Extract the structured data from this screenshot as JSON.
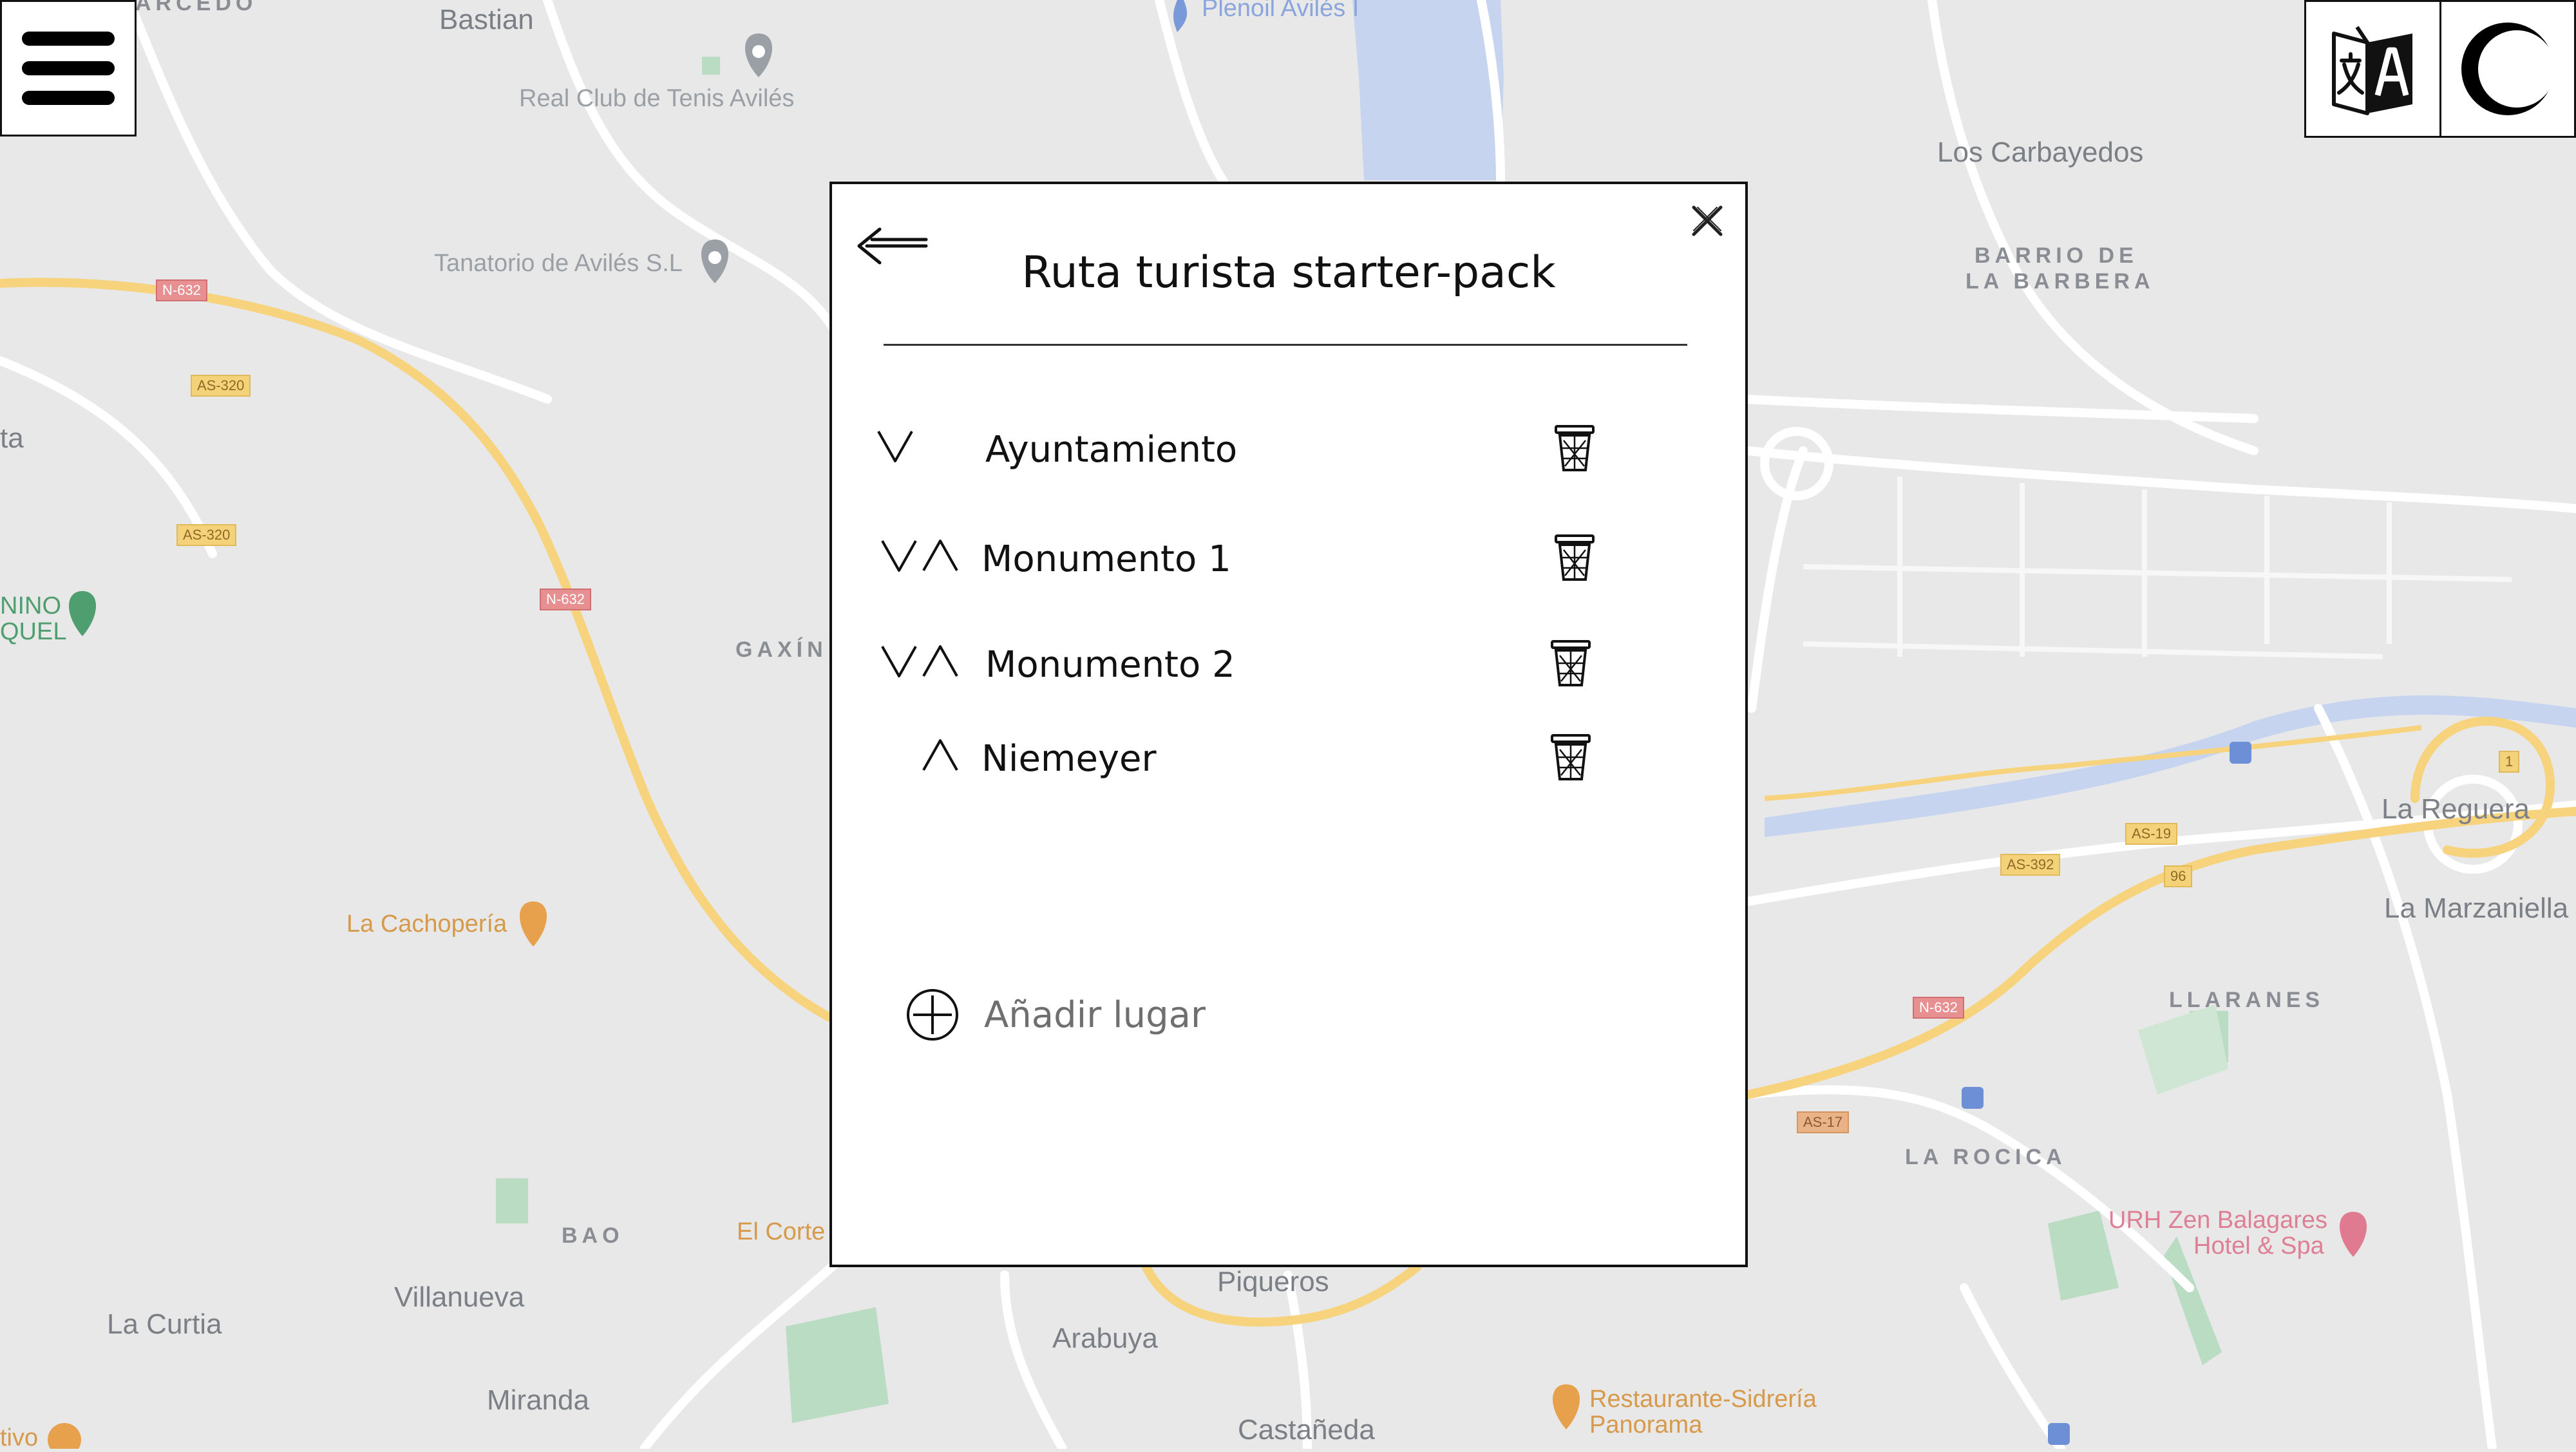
{
  "map": {
    "labels": {
      "bastian": "Bastian",
      "carcedo": "ARCEDO",
      "real_club": "Real Club de Tenis Avilés",
      "pleno": "Plenoil Avilés I",
      "tanatorio": "Tanatorio de Avilés S.L",
      "carbayedos": "Los Carbayedos",
      "barrio_barbera_1": "BARRIO DE",
      "barrio_barbera_2": "LA BARBERA",
      "gaxin": "GAXÍN",
      "cachoperia": "La Cachopería",
      "bao": "BAO",
      "el_corte": "El Corte",
      "villanueva": "Villanueva",
      "la_curtia": "La Curtia",
      "miranda": "Miranda",
      "piqueros": "Piqueros",
      "arabuya": "Arabuya",
      "castaneda": "Castañeda",
      "llaranes": "LLARANES",
      "la_rocica": "LA ROCICA",
      "la_reguera": "La Reguera",
      "la_marzaniella": "La Marzaniella",
      "urh_1": "URH Zen Balagares",
      "urh_2": "Hotel & Spa",
      "restaurante_1": "Restaurante-Sidrería",
      "restaurante_2": "Panorama",
      "nino_1": "NINO",
      "nino_2": "QUEL",
      "ta": "ta",
      "tivo": "tivo"
    },
    "shields": {
      "n632_a": "N-632",
      "as320_a": "AS-320",
      "as320_b": "AS-320",
      "n632_b": "N-632",
      "n632_c": "N-632",
      "as19": "AS-19",
      "as392": "AS-392",
      "as17": "AS-17",
      "s96": "96",
      "s1": "1"
    }
  },
  "controls": {
    "menu_icon": "hamburger-menu-icon",
    "translate_icon": "translate-icon",
    "theme_icon": "dark-mode-icon"
  },
  "dialog": {
    "title": "Ruta turista starter-pack",
    "items": [
      {
        "label": "Ayuntamiento",
        "move_down": true,
        "move_up": false
      },
      {
        "label": "Monumento 1",
        "move_down": true,
        "move_up": true
      },
      {
        "label": "Monumento 2",
        "move_down": true,
        "move_up": true
      },
      {
        "label": "Niemeyer",
        "move_down": false,
        "move_up": true
      }
    ],
    "add_label": "Añadir lugar"
  }
}
